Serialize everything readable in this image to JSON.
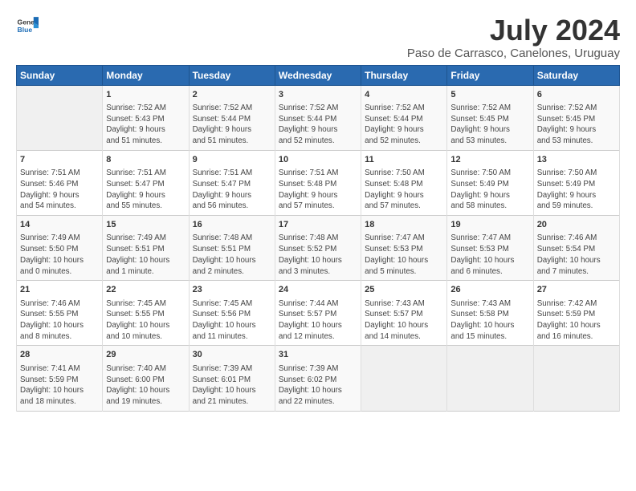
{
  "header": {
    "logo_general": "General",
    "logo_blue": "Blue",
    "title": "July 2024",
    "subtitle": "Paso de Carrasco, Canelones, Uruguay"
  },
  "columns": [
    "Sunday",
    "Monday",
    "Tuesday",
    "Wednesday",
    "Thursday",
    "Friday",
    "Saturday"
  ],
  "weeks": [
    [
      {
        "day": "",
        "lines": []
      },
      {
        "day": "1",
        "lines": [
          "Sunrise: 7:52 AM",
          "Sunset: 5:43 PM",
          "Daylight: 9 hours",
          "and 51 minutes."
        ]
      },
      {
        "day": "2",
        "lines": [
          "Sunrise: 7:52 AM",
          "Sunset: 5:44 PM",
          "Daylight: 9 hours",
          "and 51 minutes."
        ]
      },
      {
        "day": "3",
        "lines": [
          "Sunrise: 7:52 AM",
          "Sunset: 5:44 PM",
          "Daylight: 9 hours",
          "and 52 minutes."
        ]
      },
      {
        "day": "4",
        "lines": [
          "Sunrise: 7:52 AM",
          "Sunset: 5:44 PM",
          "Daylight: 9 hours",
          "and 52 minutes."
        ]
      },
      {
        "day": "5",
        "lines": [
          "Sunrise: 7:52 AM",
          "Sunset: 5:45 PM",
          "Daylight: 9 hours",
          "and 53 minutes."
        ]
      },
      {
        "day": "6",
        "lines": [
          "Sunrise: 7:52 AM",
          "Sunset: 5:45 PM",
          "Daylight: 9 hours",
          "and 53 minutes."
        ]
      }
    ],
    [
      {
        "day": "7",
        "lines": [
          "Sunrise: 7:51 AM",
          "Sunset: 5:46 PM",
          "Daylight: 9 hours",
          "and 54 minutes."
        ]
      },
      {
        "day": "8",
        "lines": [
          "Sunrise: 7:51 AM",
          "Sunset: 5:47 PM",
          "Daylight: 9 hours",
          "and 55 minutes."
        ]
      },
      {
        "day": "9",
        "lines": [
          "Sunrise: 7:51 AM",
          "Sunset: 5:47 PM",
          "Daylight: 9 hours",
          "and 56 minutes."
        ]
      },
      {
        "day": "10",
        "lines": [
          "Sunrise: 7:51 AM",
          "Sunset: 5:48 PM",
          "Daylight: 9 hours",
          "and 57 minutes."
        ]
      },
      {
        "day": "11",
        "lines": [
          "Sunrise: 7:50 AM",
          "Sunset: 5:48 PM",
          "Daylight: 9 hours",
          "and 57 minutes."
        ]
      },
      {
        "day": "12",
        "lines": [
          "Sunrise: 7:50 AM",
          "Sunset: 5:49 PM",
          "Daylight: 9 hours",
          "and 58 minutes."
        ]
      },
      {
        "day": "13",
        "lines": [
          "Sunrise: 7:50 AM",
          "Sunset: 5:49 PM",
          "Daylight: 9 hours",
          "and 59 minutes."
        ]
      }
    ],
    [
      {
        "day": "14",
        "lines": [
          "Sunrise: 7:49 AM",
          "Sunset: 5:50 PM",
          "Daylight: 10 hours",
          "and 0 minutes."
        ]
      },
      {
        "day": "15",
        "lines": [
          "Sunrise: 7:49 AM",
          "Sunset: 5:51 PM",
          "Daylight: 10 hours",
          "and 1 minute."
        ]
      },
      {
        "day": "16",
        "lines": [
          "Sunrise: 7:48 AM",
          "Sunset: 5:51 PM",
          "Daylight: 10 hours",
          "and 2 minutes."
        ]
      },
      {
        "day": "17",
        "lines": [
          "Sunrise: 7:48 AM",
          "Sunset: 5:52 PM",
          "Daylight: 10 hours",
          "and 3 minutes."
        ]
      },
      {
        "day": "18",
        "lines": [
          "Sunrise: 7:47 AM",
          "Sunset: 5:53 PM",
          "Daylight: 10 hours",
          "and 5 minutes."
        ]
      },
      {
        "day": "19",
        "lines": [
          "Sunrise: 7:47 AM",
          "Sunset: 5:53 PM",
          "Daylight: 10 hours",
          "and 6 minutes."
        ]
      },
      {
        "day": "20",
        "lines": [
          "Sunrise: 7:46 AM",
          "Sunset: 5:54 PM",
          "Daylight: 10 hours",
          "and 7 minutes."
        ]
      }
    ],
    [
      {
        "day": "21",
        "lines": [
          "Sunrise: 7:46 AM",
          "Sunset: 5:55 PM",
          "Daylight: 10 hours",
          "and 8 minutes."
        ]
      },
      {
        "day": "22",
        "lines": [
          "Sunrise: 7:45 AM",
          "Sunset: 5:55 PM",
          "Daylight: 10 hours",
          "and 10 minutes."
        ]
      },
      {
        "day": "23",
        "lines": [
          "Sunrise: 7:45 AM",
          "Sunset: 5:56 PM",
          "Daylight: 10 hours",
          "and 11 minutes."
        ]
      },
      {
        "day": "24",
        "lines": [
          "Sunrise: 7:44 AM",
          "Sunset: 5:57 PM",
          "Daylight: 10 hours",
          "and 12 minutes."
        ]
      },
      {
        "day": "25",
        "lines": [
          "Sunrise: 7:43 AM",
          "Sunset: 5:57 PM",
          "Daylight: 10 hours",
          "and 14 minutes."
        ]
      },
      {
        "day": "26",
        "lines": [
          "Sunrise: 7:43 AM",
          "Sunset: 5:58 PM",
          "Daylight: 10 hours",
          "and 15 minutes."
        ]
      },
      {
        "day": "27",
        "lines": [
          "Sunrise: 7:42 AM",
          "Sunset: 5:59 PM",
          "Daylight: 10 hours",
          "and 16 minutes."
        ]
      }
    ],
    [
      {
        "day": "28",
        "lines": [
          "Sunrise: 7:41 AM",
          "Sunset: 5:59 PM",
          "Daylight: 10 hours",
          "and 18 minutes."
        ]
      },
      {
        "day": "29",
        "lines": [
          "Sunrise: 7:40 AM",
          "Sunset: 6:00 PM",
          "Daylight: 10 hours",
          "and 19 minutes."
        ]
      },
      {
        "day": "30",
        "lines": [
          "Sunrise: 7:39 AM",
          "Sunset: 6:01 PM",
          "Daylight: 10 hours",
          "and 21 minutes."
        ]
      },
      {
        "day": "31",
        "lines": [
          "Sunrise: 7:39 AM",
          "Sunset: 6:02 PM",
          "Daylight: 10 hours",
          "and 22 minutes."
        ]
      },
      {
        "day": "",
        "lines": []
      },
      {
        "day": "",
        "lines": []
      },
      {
        "day": "",
        "lines": []
      }
    ]
  ]
}
